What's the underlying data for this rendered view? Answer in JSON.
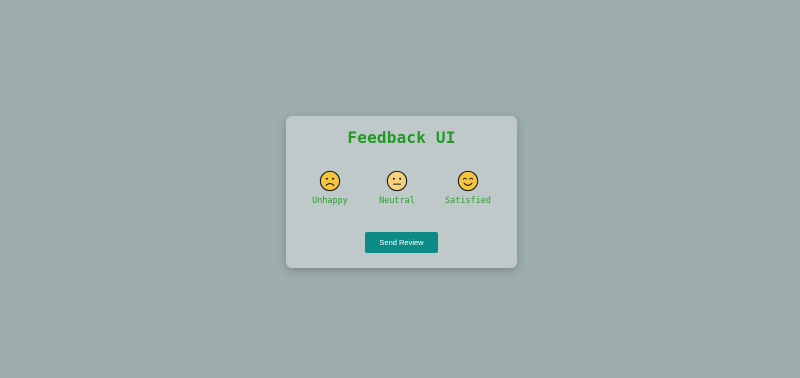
{
  "feedback": {
    "title": "Feedback UI",
    "ratings": [
      {
        "label": "Unhappy",
        "icon": "sad-face-icon"
      },
      {
        "label": "Neutral",
        "icon": "neutral-face-icon"
      },
      {
        "label": "Satisfied",
        "icon": "smiling-face-icon"
      }
    ],
    "send_label": "Send Review"
  },
  "colors": {
    "background": "#9eaeae",
    "card": "#bfc9c9",
    "accent_green": "#1f9b24",
    "button": "#0b8a86",
    "emoji_fill": "#f5c63a"
  }
}
